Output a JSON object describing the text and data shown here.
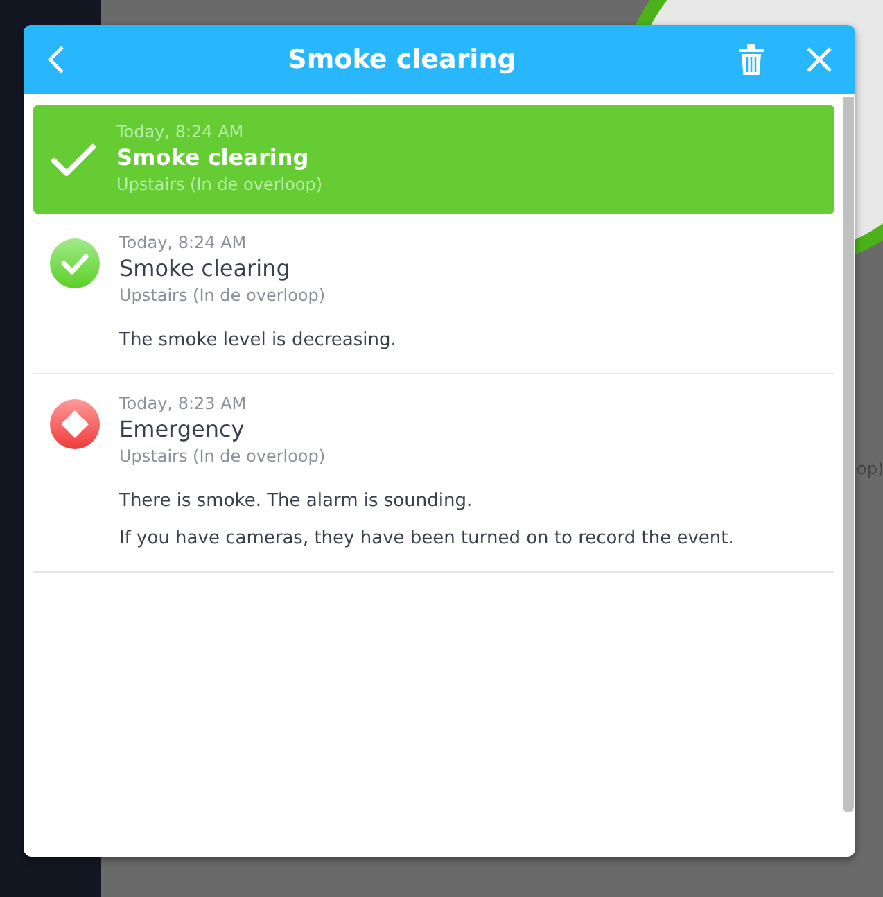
{
  "background": {
    "fragment": "op)"
  },
  "dialog": {
    "title": "Smoke clearing"
  },
  "events": [
    {
      "kind": "ok",
      "selected": true,
      "time": "Today, 8:24 AM",
      "title": "Smoke clearing",
      "location": "Upstairs (In de overloop)"
    },
    {
      "kind": "ok",
      "selected": false,
      "time": "Today, 8:24 AM",
      "title": "Smoke clearing",
      "location": "Upstairs (In de overloop)",
      "details": [
        "The smoke level is decreasing."
      ]
    },
    {
      "kind": "alarm",
      "selected": false,
      "time": "Today, 8:23 AM",
      "title": "Emergency",
      "location": "Upstairs (In de overloop)",
      "details": [
        "There is smoke. The alarm is sounding.",
        "If you have cameras, they have been turned on to record the event."
      ]
    }
  ]
}
